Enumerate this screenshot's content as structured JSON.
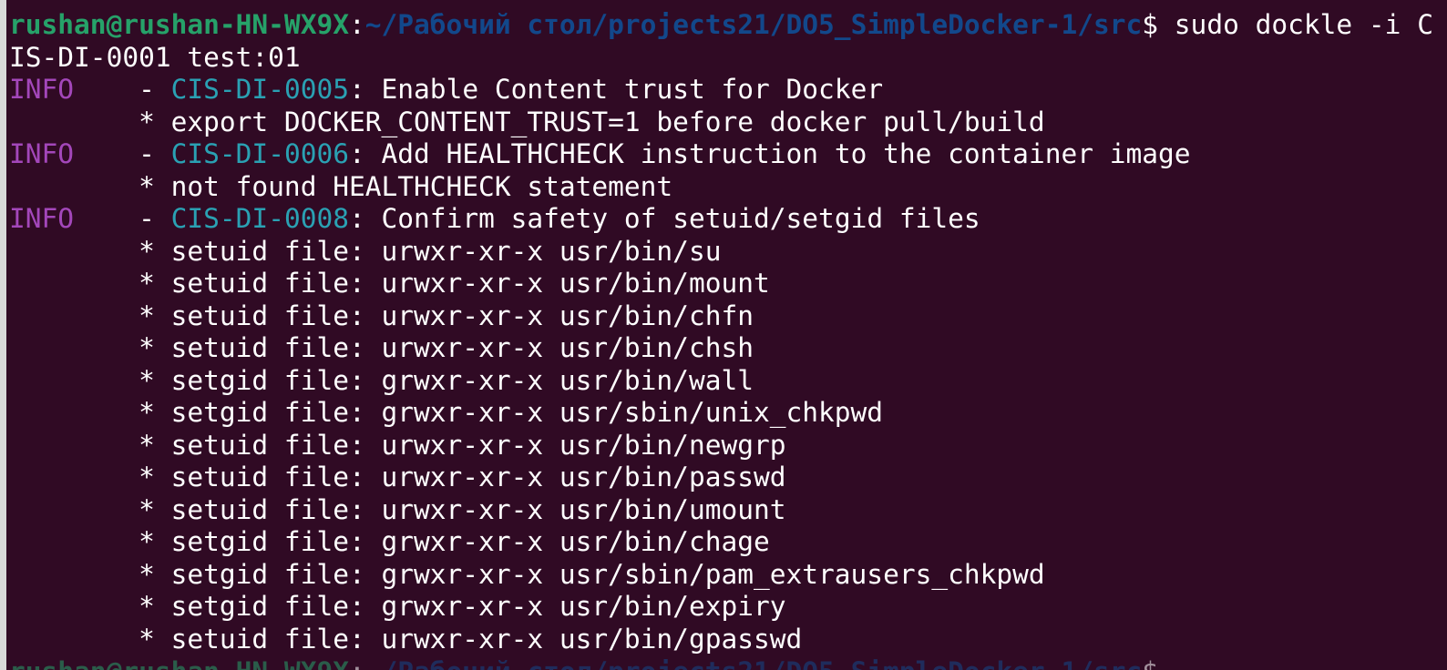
{
  "terminal": {
    "prompt": {
      "user": "rushan@rushan-HN-WX9X",
      "colon": ":",
      "path": "~/Рабочий стол/projects21/DO5_SimpleDocker-1/src",
      "dollar": "$ ",
      "command": "sudo dockle -i C"
    },
    "output": {
      "image_line": "IS-DI-0001 test:01",
      "checks": [
        {
          "level": "INFO",
          "sep": "    - ",
          "code": "CIS-DI-0005",
          "title": ": Enable Content trust for Docker",
          "details": [
            "        * export DOCKER_CONTENT_TRUST=1 before docker pull/build"
          ]
        },
        {
          "level": "INFO",
          "sep": "    - ",
          "code": "CIS-DI-0006",
          "title": ": Add HEALTHCHECK instruction to the container image",
          "details": [
            "        * not found HEALTHCHECK statement"
          ]
        },
        {
          "level": "INFO",
          "sep": "    - ",
          "code": "CIS-DI-0008",
          "title": ": Confirm safety of setuid/setgid files",
          "details": [
            "        * setuid file: urwxr-xr-x usr/bin/su",
            "        * setuid file: urwxr-xr-x usr/bin/mount",
            "        * setuid file: urwxr-xr-x usr/bin/chfn",
            "        * setuid file: urwxr-xr-x usr/bin/chsh",
            "        * setgid file: grwxr-xr-x usr/bin/wall",
            "        * setgid file: grwxr-xr-x usr/sbin/unix_chkpwd",
            "        * setuid file: urwxr-xr-x usr/bin/newgrp",
            "        * setuid file: urwxr-xr-x usr/bin/passwd",
            "        * setuid file: urwxr-xr-x usr/bin/umount",
            "        * setgid file: grwxr-xr-x usr/bin/chage",
            "        * setgid file: grwxr-xr-x usr/sbin/pam_extrausers_chkpwd",
            "        * setgid file: grwxr-xr-x usr/bin/expiry",
            "        * setuid file: urwxr-xr-x usr/bin/gpasswd"
          ]
        }
      ]
    }
  },
  "colors": {
    "background": "#300a24",
    "user": "#26a269",
    "path": "#12488b",
    "info": "#a347ba",
    "code": "#2aa1b3",
    "text": "#ffffff"
  }
}
